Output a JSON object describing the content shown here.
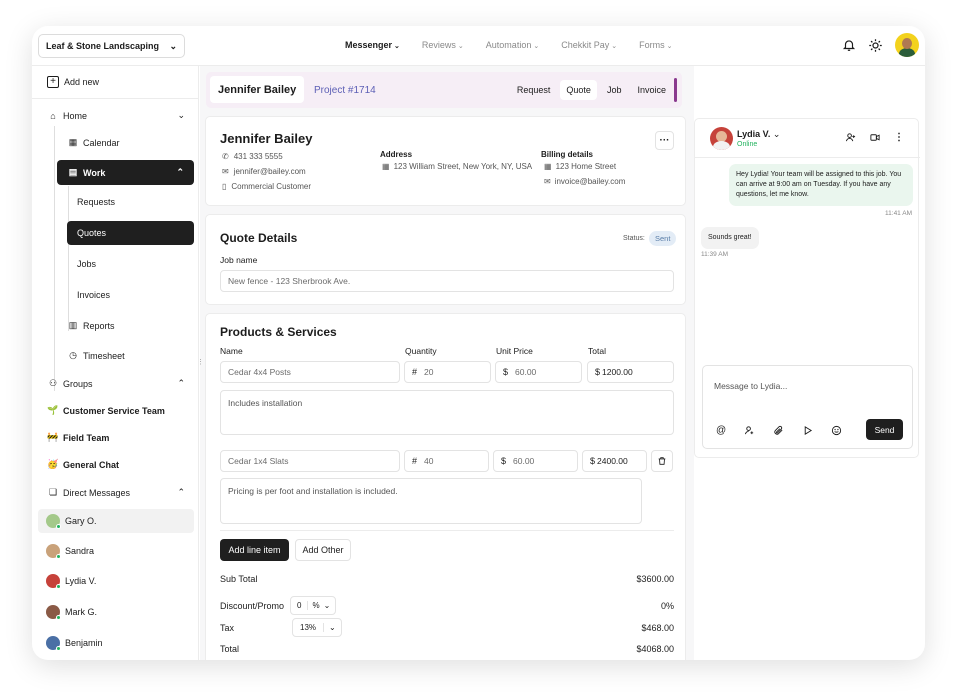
{
  "topbar": {
    "company": "Leaf & Stone Landscaping",
    "nav": [
      {
        "label": "Messenger",
        "active": true
      },
      {
        "label": "Reviews"
      },
      {
        "label": "Automation"
      },
      {
        "label": "Chekkit Pay"
      },
      {
        "label": "Forms"
      }
    ]
  },
  "sidebar": {
    "add_new": "Add new",
    "home": "Home",
    "calendar": "Calendar",
    "work": "Work",
    "requests": "Requests",
    "quotes": "Quotes",
    "jobs": "Jobs",
    "invoices": "Invoices",
    "reports": "Reports",
    "timesheet": "Timesheet",
    "groups": "Groups",
    "group_items": [
      "Customer Service Team",
      "Field Team",
      "General Chat"
    ],
    "group_emojis": [
      "🌱",
      "🚧",
      "🥳"
    ],
    "direct_messages": "Direct Messages",
    "dms": [
      "Gary O.",
      "Sandra",
      "Lydia V.",
      "Mark G.",
      "Benjamin"
    ]
  },
  "header": {
    "name": "Jennifer Bailey",
    "project": "Project #1714",
    "tabs": [
      "Request",
      "Quote",
      "Job",
      "Invoice"
    ],
    "active_tab": "Quote"
  },
  "customer": {
    "name": "Jennifer Bailey",
    "phone": "431 333 5555",
    "email": "jennifer@bailey.com",
    "type": "Commercial Customer",
    "address_label": "Address",
    "address": "123 William Street, New York, NY, USA",
    "billing_label": "Billing details",
    "billing_address": "123 Home Street",
    "billing_email": "invoice@bailey.com",
    "more": "···"
  },
  "quote": {
    "title": "Quote Details",
    "status_label": "Status:",
    "status": "Sent",
    "job_name_label": "Job name",
    "job_name": "New fence - 123 Sherbrook Ave."
  },
  "products": {
    "title": "Products & Services",
    "columns": [
      "Name",
      "Quantity",
      "Unit Price",
      "Total"
    ],
    "items": [
      {
        "name": "Cedar 4x4 Posts",
        "qty": "20",
        "price": "60.00",
        "total": "1200.00",
        "note": "Includes installation"
      },
      {
        "name": "Cedar 1x4 Slats",
        "qty": "40",
        "price": "60.00",
        "total": "2400.00",
        "note": "Pricing is per foot and installation is included."
      }
    ],
    "hash": "#",
    "dollar": "$",
    "add_line": "Add line item",
    "add_other": "Add Other",
    "subtotal_label": "Sub Total",
    "subtotal": "$3600.00",
    "discount_label": "Discount/Promo",
    "discount_value": "0",
    "discount_unit": "%",
    "discount": "0%",
    "tax_label": "Tax",
    "tax_rate": "13%",
    "tax": "$468.00",
    "total_label": "Total",
    "total": "$4068.00"
  },
  "chat": {
    "name": "Lydia V.",
    "status": "Online",
    "messages": [
      {
        "text": "Hey Lydia! Your team will be assigned to this job. You can arrive at 9:00 am on Tuesday. If you have any questions, let me know.",
        "time": "11:41 AM"
      },
      {
        "text": "Sounds great!",
        "time": "11:39 AM"
      }
    ],
    "placeholder": "Message to Lydia...",
    "send": "Send"
  },
  "colors": {
    "accent": "#8a3a8e",
    "online": "#22b35e",
    "project": "#5c5fb5"
  }
}
